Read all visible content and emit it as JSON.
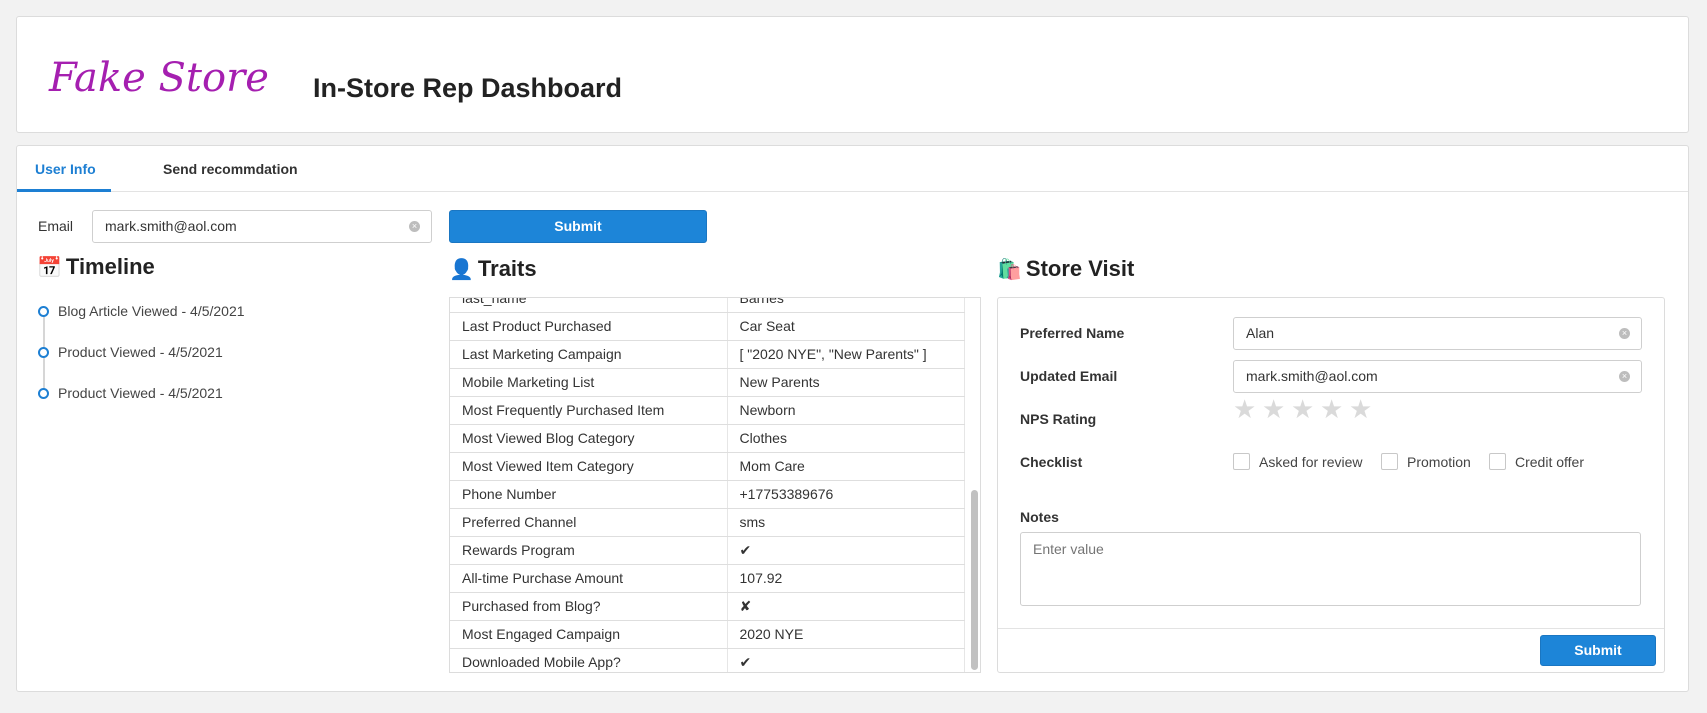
{
  "header": {
    "logo_text": "Fake Store",
    "title": "In-Store Rep Dashboard"
  },
  "tabs": [
    {
      "label": "User Info",
      "active": true
    },
    {
      "label": "Send recommdation",
      "active": false
    }
  ],
  "lookup": {
    "email_label": "Email",
    "email_value": "mark.smith@aol.com",
    "submit_label": "Submit"
  },
  "timeline": {
    "title": "Timeline",
    "icon": "calendar-icon",
    "events": [
      "Blog Article Viewed - 4/5/2021",
      "Product Viewed - 4/5/2021",
      "Product Viewed - 4/5/2021"
    ]
  },
  "traits": {
    "title": "Traits",
    "icon": "person-icon",
    "partial_row": {
      "key": "last_name",
      "value": "Barnes"
    },
    "rows": [
      {
        "key": "Last Product Purchased",
        "value": "Car Seat"
      },
      {
        "key": "Last Marketing Campaign",
        "value": "[ \"2020 NYE\", \"New Parents\" ]"
      },
      {
        "key": "Mobile Marketing List",
        "value": "New Parents"
      },
      {
        "key": "Most Frequently Purchased Item",
        "value": "Newborn"
      },
      {
        "key": "Most Viewed Blog Category",
        "value": "Clothes"
      },
      {
        "key": "Most Viewed Item Category",
        "value": "Mom Care"
      },
      {
        "key": "Phone Number",
        "value": "+17753389676"
      },
      {
        "key": "Preferred Channel",
        "value": "sms"
      },
      {
        "key": "Rewards Program",
        "value": "✔"
      },
      {
        "key": "All-time Purchase Amount",
        "value": "107.92"
      },
      {
        "key": "Purchased from Blog?",
        "value": "✘"
      },
      {
        "key": "Most Engaged Campaign",
        "value": "2020 NYE"
      },
      {
        "key": "Downloaded Mobile App?",
        "value": "✔"
      }
    ]
  },
  "store_visit": {
    "title": "Store Visit",
    "icon": "shopping-bags-icon",
    "preferred_name_label": "Preferred Name",
    "preferred_name_value": "Alan",
    "updated_email_label": "Updated Email",
    "updated_email_value": "mark.smith@aol.com",
    "nps_label": "NPS Rating",
    "nps_rating": 0,
    "nps_max": 5,
    "checklist_label": "Checklist",
    "checklist": [
      "Asked for review",
      "Promotion",
      "Credit offer"
    ],
    "notes_label": "Notes",
    "notes_placeholder": "Enter value",
    "submit_label": "Submit"
  },
  "colors": {
    "accent": "#1d85d8",
    "logo": "#a51fb0"
  }
}
